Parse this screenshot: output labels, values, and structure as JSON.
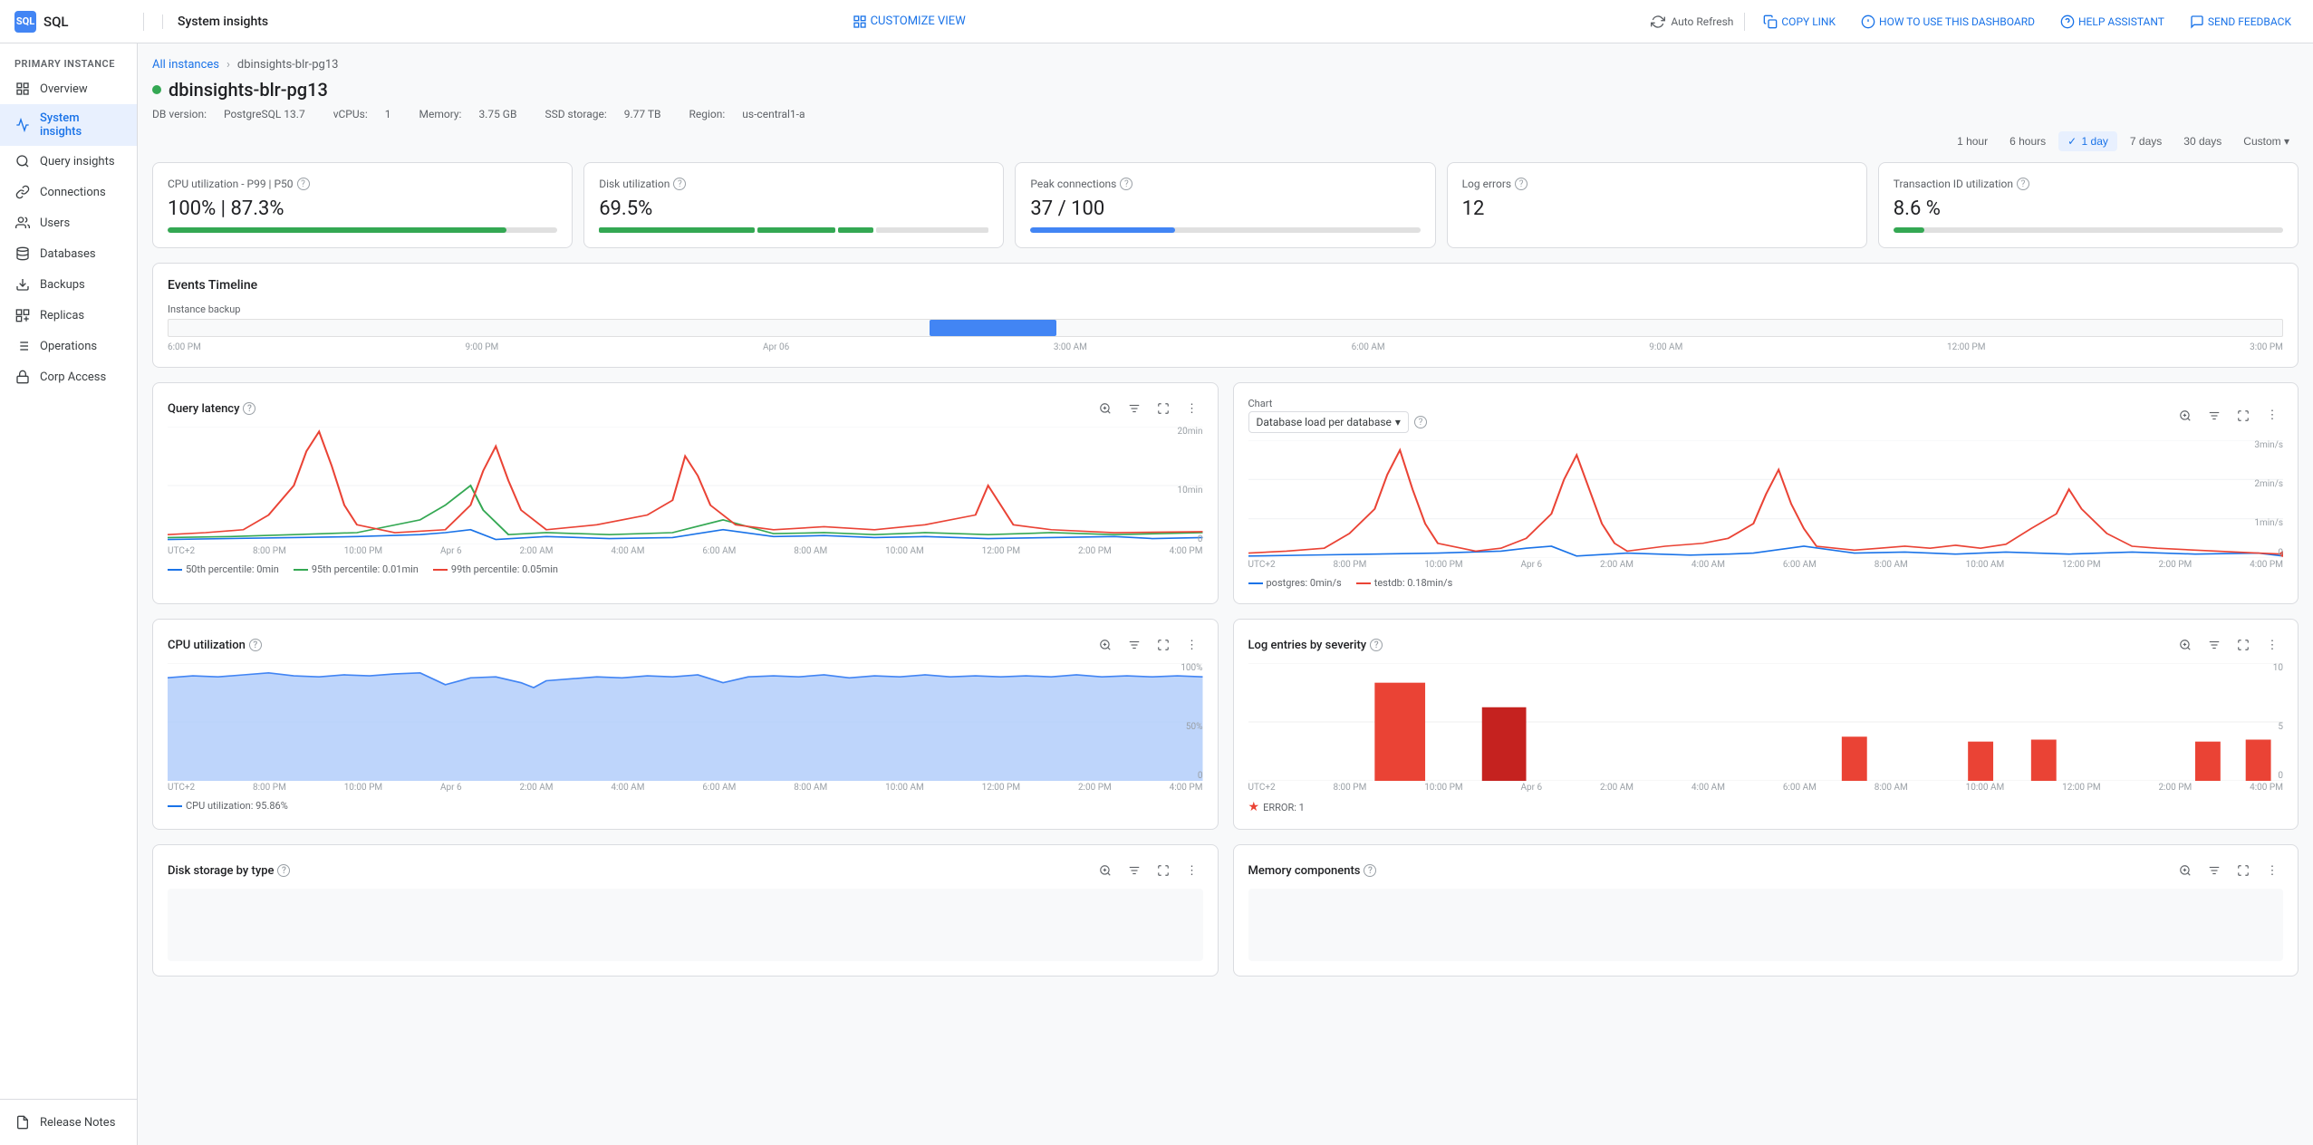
{
  "topbar": {
    "logo_text": "SQL",
    "page_title": "System insights",
    "customize_label": "CUSTOMIZE VIEW",
    "auto_refresh_label": "Auto Refresh",
    "copy_link_label": "COPY LINK",
    "how_to_use_label": "HOW TO USE THIS DASHBOARD",
    "help_assistant_label": "HELP ASSISTANT",
    "send_feedback_label": "SEND FEEDBACK"
  },
  "sidebar": {
    "section_label": "PRIMARY INSTANCE",
    "items": [
      {
        "id": "overview",
        "label": "Overview",
        "active": false
      },
      {
        "id": "system-insights",
        "label": "System insights",
        "active": true
      },
      {
        "id": "query-insights",
        "label": "Query insights",
        "active": false
      },
      {
        "id": "connections",
        "label": "Connections",
        "active": false
      },
      {
        "id": "users",
        "label": "Users",
        "active": false
      },
      {
        "id": "databases",
        "label": "Databases",
        "active": false
      },
      {
        "id": "backups",
        "label": "Backups",
        "active": false
      },
      {
        "id": "replicas",
        "label": "Replicas",
        "active": false
      },
      {
        "id": "operations",
        "label": "Operations",
        "active": false
      },
      {
        "id": "corp-access",
        "label": "Corp Access",
        "active": false
      }
    ],
    "footer_item": "Release Notes"
  },
  "breadcrumb": {
    "parent": "All instances",
    "current": "dbinsights-blr-pg13"
  },
  "instance": {
    "name": "dbinsights-blr-pg13",
    "status": "running",
    "db_version": "PostgreSQL 13.7",
    "vcpus": "1",
    "memory": "3.75 GB",
    "ssd_storage": "9.77 TB",
    "region": "us-central1-a",
    "meta_labels": {
      "db_version_label": "DB version:",
      "vcpus_label": "vCPUs:",
      "memory_label": "Memory:",
      "ssd_label": "SSD storage:",
      "region_label": "Region:"
    }
  },
  "time_range": {
    "options": [
      "1 hour",
      "6 hours",
      "1 day",
      "7 days",
      "30 days",
      "Custom"
    ],
    "active": "1 day"
  },
  "metrics": [
    {
      "id": "cpu-util",
      "label": "CPU utilization - P99 | P50",
      "value": "100% | 87.3%",
      "bar_percent": 87,
      "bar_color": "green"
    },
    {
      "id": "disk-util",
      "label": "Disk utilization",
      "value": "69.5%",
      "bar_percent": 69,
      "bar_color": "green",
      "has_segments": true
    },
    {
      "id": "peak-connections",
      "label": "Peak connections",
      "value": "37 / 100",
      "bar_percent": 37,
      "bar_color": "blue"
    },
    {
      "id": "log-errors",
      "label": "Log errors",
      "value": "12",
      "no_bar": true
    },
    {
      "id": "transaction-id",
      "label": "Transaction ID utilization",
      "value": "8.6 %",
      "bar_percent": 8,
      "bar_color": "green"
    }
  ],
  "events_timeline": {
    "title": "Events Timeline",
    "event_label": "Instance backup",
    "ticks": [
      "6:00 PM",
      "9:00 PM",
      "Apr 06",
      "3:00 AM",
      "6:00 AM",
      "9:00 AM",
      "12:00 PM",
      "3:00 PM"
    ]
  },
  "query_latency": {
    "title": "Query latency",
    "y_labels": [
      "20min",
      "10min",
      "0"
    ],
    "x_ticks": [
      "UTC+2",
      "8:00 PM",
      "10:00 PM",
      "Apr 6",
      "2:00 AM",
      "4:00 AM",
      "6:00 AM",
      "8:00 AM",
      "10:00 AM",
      "12:00 PM",
      "2:00 PM",
      "4:00 PM"
    ],
    "legend": [
      {
        "id": "p50",
        "label": "50th percentile: 0min",
        "color": "#1a73e8",
        "type": "line"
      },
      {
        "id": "p95",
        "label": "95th percentile: 0.01min",
        "color": "#34a853",
        "type": "line"
      },
      {
        "id": "p99",
        "label": "99th percentile: 0.05min",
        "color": "#ea4335",
        "type": "line"
      }
    ]
  },
  "db_load": {
    "title": "Chart",
    "dropdown_label": "Database load per database",
    "y_labels": [
      "3min/s",
      "2min/s",
      "1min/s",
      "0"
    ],
    "x_ticks": [
      "UTC+2",
      "8:00 PM",
      "10:00 PM",
      "Apr 6",
      "2:00 AM",
      "4:00 AM",
      "6:00 AM",
      "8:00 AM",
      "10:00 AM",
      "12:00 PM",
      "2:00 PM",
      "4:00 PM"
    ],
    "legend": [
      {
        "id": "postgres",
        "label": "postgres: 0min/s",
        "color": "#1a73e8",
        "type": "line"
      },
      {
        "id": "testdb",
        "label": "testdb: 0.18min/s",
        "color": "#ea4335",
        "type": "line"
      }
    ]
  },
  "cpu_utilization_chart": {
    "title": "CPU utilization",
    "y_labels": [
      "100%",
      "50%",
      "0"
    ],
    "x_ticks": [
      "UTC+2",
      "8:00 PM",
      "10:00 PM",
      "Apr 6",
      "2:00 AM",
      "4:00 AM",
      "6:00 AM",
      "8:00 AM",
      "10:00 AM",
      "12:00 PM",
      "2:00 PM",
      "4:00 PM"
    ],
    "legend_label": "CPU utilization: 95.86%",
    "legend_color": "#1a73e8"
  },
  "log_severity": {
    "title": "Log entries by severity",
    "y_labels": [
      "10",
      "5",
      "0"
    ],
    "x_ticks": [
      "UTC+2",
      "8:00 PM",
      "10:00 PM",
      "Apr 6",
      "2:00 AM",
      "4:00 AM",
      "6:00 AM",
      "8:00 AM",
      "10:00 AM",
      "12:00 PM",
      "2:00 PM",
      "4:00 PM"
    ],
    "legend": [
      {
        "id": "error",
        "label": "ERROR: 1",
        "color": "#ea4335",
        "type": "star"
      }
    ]
  },
  "disk_storage": {
    "title": "Disk storage by type"
  },
  "memory_components": {
    "title": "Memory components"
  },
  "icons": {
    "help": "?",
    "zoom": "🔍",
    "filter": "≡",
    "expand": "⤢",
    "more": "⋮",
    "chevron_down": "▾",
    "check": "✓"
  }
}
